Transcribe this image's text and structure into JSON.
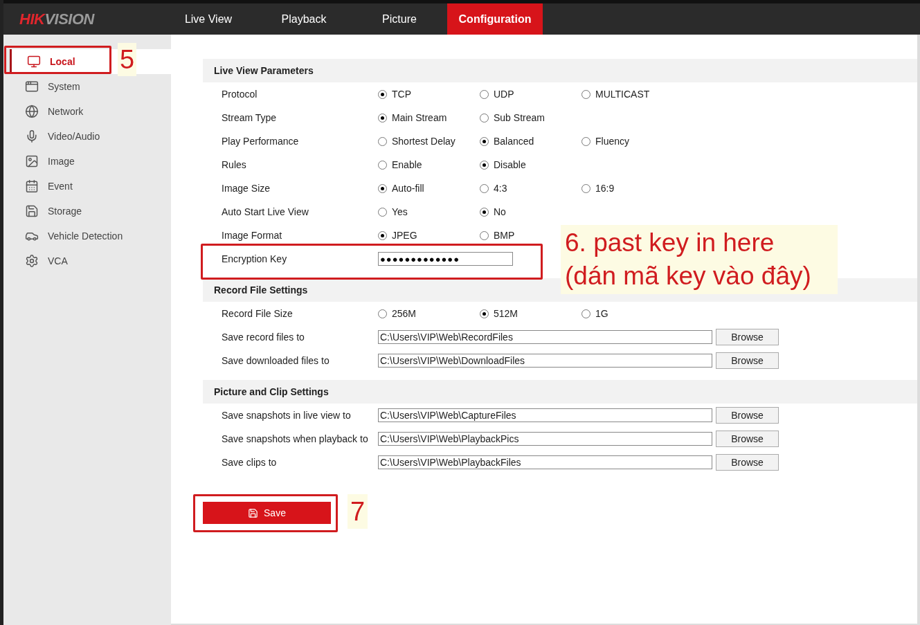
{
  "header": {
    "logo": [
      "HIK",
      "VISION"
    ],
    "tabs": [
      {
        "label": "Live View",
        "selected": false
      },
      {
        "label": "Playback",
        "selected": false
      },
      {
        "label": "Picture",
        "selected": false
      },
      {
        "label": "Configuration",
        "selected": true
      }
    ]
  },
  "sidebar": {
    "items": [
      {
        "label": "Local",
        "selected": true
      },
      {
        "label": "System",
        "selected": false
      },
      {
        "label": "Network",
        "selected": false
      },
      {
        "label": "Video/Audio",
        "selected": false
      },
      {
        "label": "Image",
        "selected": false
      },
      {
        "label": "Event",
        "selected": false
      },
      {
        "label": "Storage",
        "selected": false
      },
      {
        "label": "Vehicle Detection",
        "selected": false
      },
      {
        "label": "VCA",
        "selected": false
      }
    ]
  },
  "sections": [
    {
      "title": "Live View Parameters",
      "rows": [
        {
          "kind": "radio",
          "label": "Protocol",
          "options": [
            {
              "label": "TCP",
              "selected": true
            },
            {
              "label": "UDP",
              "selected": false
            },
            {
              "label": "MULTICAST",
              "selected": false
            }
          ]
        },
        {
          "kind": "radio",
          "label": "Stream Type",
          "options": [
            {
              "label": "Main Stream",
              "selected": true
            },
            {
              "label": "Sub Stream",
              "selected": false
            }
          ]
        },
        {
          "kind": "radio",
          "label": "Play Performance",
          "options": [
            {
              "label": "Shortest Delay",
              "selected": false
            },
            {
              "label": "Balanced",
              "selected": true
            },
            {
              "label": "Fluency",
              "selected": false
            }
          ]
        },
        {
          "kind": "radio",
          "label": "Rules",
          "options": [
            {
              "label": "Enable",
              "selected": false
            },
            {
              "label": "Disable",
              "selected": true
            }
          ]
        },
        {
          "kind": "radio",
          "label": "Image Size",
          "options": [
            {
              "label": "Auto-fill",
              "selected": true
            },
            {
              "label": "4:3",
              "selected": false
            },
            {
              "label": "16:9",
              "selected": false
            }
          ]
        },
        {
          "kind": "radio",
          "label": "Auto Start Live View",
          "options": [
            {
              "label": "Yes",
              "selected": false
            },
            {
              "label": "No",
              "selected": true
            }
          ]
        },
        {
          "kind": "radio",
          "label": "Image Format",
          "options": [
            {
              "label": "JPEG",
              "selected": true
            },
            {
              "label": "BMP",
              "selected": false
            }
          ]
        },
        {
          "kind": "password",
          "label": "Encryption Key",
          "value": "●●●●●●●●●●●●●"
        }
      ]
    },
    {
      "title": "Record File Settings",
      "rows": [
        {
          "kind": "radio",
          "label": "Record File Size",
          "options": [
            {
              "label": "256M",
              "selected": false
            },
            {
              "label": "512M",
              "selected": true
            },
            {
              "label": "1G",
              "selected": false
            }
          ]
        },
        {
          "kind": "path",
          "label": "Save record files to",
          "value": "C:\\Users\\VIP\\Web\\RecordFiles",
          "button": "Browse"
        },
        {
          "kind": "path",
          "label": "Save downloaded files to",
          "value": "C:\\Users\\VIP\\Web\\DownloadFiles",
          "button": "Browse"
        }
      ]
    },
    {
      "title": "Picture and Clip Settings",
      "rows": [
        {
          "kind": "path",
          "label": "Save snapshots in live view to",
          "value": "C:\\Users\\VIP\\Web\\CaptureFiles",
          "button": "Browse"
        },
        {
          "kind": "path",
          "label": "Save snapshots when playback to",
          "value": "C:\\Users\\VIP\\Web\\PlaybackPics",
          "button": "Browse"
        },
        {
          "kind": "path",
          "label": "Save clips to",
          "value": "C:\\Users\\VIP\\Web\\PlaybackFiles",
          "button": "Browse"
        }
      ]
    }
  ],
  "save_button": "Save",
  "annotations": {
    "step_local": "5",
    "step_key": [
      "6. past key in here",
      "(dán mã key vào đây)"
    ],
    "step_save": "7"
  }
}
